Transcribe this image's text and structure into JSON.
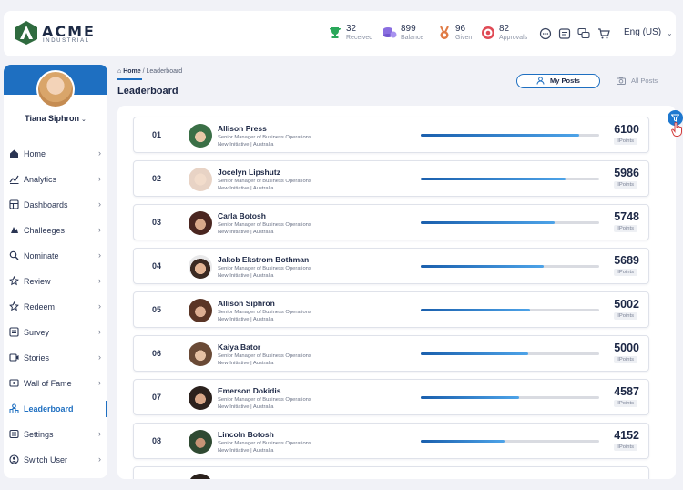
{
  "brand": {
    "name": "ACME",
    "sub": "INDUSTRIAL"
  },
  "header": {
    "stats": [
      {
        "icon": "trophy-icon",
        "value": "32",
        "label": "Received",
        "color": "#2aa85a"
      },
      {
        "icon": "coins-icon",
        "value": "899",
        "label": "Balance",
        "color": "#8a6ee0"
      },
      {
        "icon": "medal-icon",
        "value": "96",
        "label": "Given",
        "color": "#e07b45"
      },
      {
        "icon": "target-icon",
        "value": "82",
        "label": "Approvals",
        "color": "#e04a55"
      }
    ],
    "language": "Eng (US)"
  },
  "user": {
    "name": "Tiana Siphron"
  },
  "nav": [
    {
      "label": "Home",
      "icon": "home-icon"
    },
    {
      "label": "Analytics",
      "icon": "analytics-icon"
    },
    {
      "label": "Dashboards",
      "icon": "dashboard-icon"
    },
    {
      "label": "Challeeges",
      "icon": "challenges-icon"
    },
    {
      "label": "Nominate",
      "icon": "nominate-icon"
    },
    {
      "label": "Review",
      "icon": "review-icon"
    },
    {
      "label": "Redeem",
      "icon": "redeem-icon"
    },
    {
      "label": "Survey",
      "icon": "survey-icon"
    },
    {
      "label": "Stories",
      "icon": "stories-icon"
    },
    {
      "label": "Wall of Fame",
      "icon": "wall-of-fame-icon"
    },
    {
      "label": "Leaderboard",
      "icon": "leaderboard-icon",
      "active": true
    },
    {
      "label": "Settings",
      "icon": "settings-icon"
    },
    {
      "label": "Switch User",
      "icon": "switch-user-icon"
    }
  ],
  "breadcrumb": {
    "home": "Home",
    "separator": "/",
    "current": "Leaderboard"
  },
  "page": {
    "title": "Leaderboard"
  },
  "toggle": {
    "my_posts": "My Posts",
    "all_posts": "All Posts"
  },
  "leaderboard": {
    "points_label": "IPoints",
    "rows": [
      {
        "rank": "01",
        "name": "Allison Press",
        "role": "Senior Manager of Business Operations",
        "dept": "New Initiative | Australia",
        "points": "6100",
        "progress": 0.89
      },
      {
        "rank": "02",
        "name": "Jocelyn Lipshutz",
        "role": "Senior Manager of Business Operations",
        "dept": "New Initiative | Australia",
        "points": "5986",
        "progress": 0.81
      },
      {
        "rank": "03",
        "name": "Carla Botosh",
        "role": "Senior Manager of Business Operations",
        "dept": "New Initiative | Australia",
        "points": "5748",
        "progress": 0.75
      },
      {
        "rank": "04",
        "name": "Jakob Ekstrom Bothman",
        "role": "Senior Manager of Business Operations",
        "dept": "New Initiative | Australia",
        "points": "5689",
        "progress": 0.69
      },
      {
        "rank": "05",
        "name": "Allison Siphron",
        "role": "Senior Manager of Business Operations",
        "dept": "New Initiative | Australia",
        "points": "5002",
        "progress": 0.61
      },
      {
        "rank": "06",
        "name": "Kaiya Bator",
        "role": "Senior Manager of Business Operations",
        "dept": "New Initiative | Australia",
        "points": "5000",
        "progress": 0.6
      },
      {
        "rank": "07",
        "name": "Emerson Dokidis",
        "role": "Senior Manager of Business Operations",
        "dept": "New Initiative | Australia",
        "points": "4587",
        "progress": 0.55
      },
      {
        "rank": "08",
        "name": "Lincoln Botosh",
        "role": "Senior Manager of Business Operations",
        "dept": "New Initiative | Australia",
        "points": "4152",
        "progress": 0.47
      }
    ]
  }
}
